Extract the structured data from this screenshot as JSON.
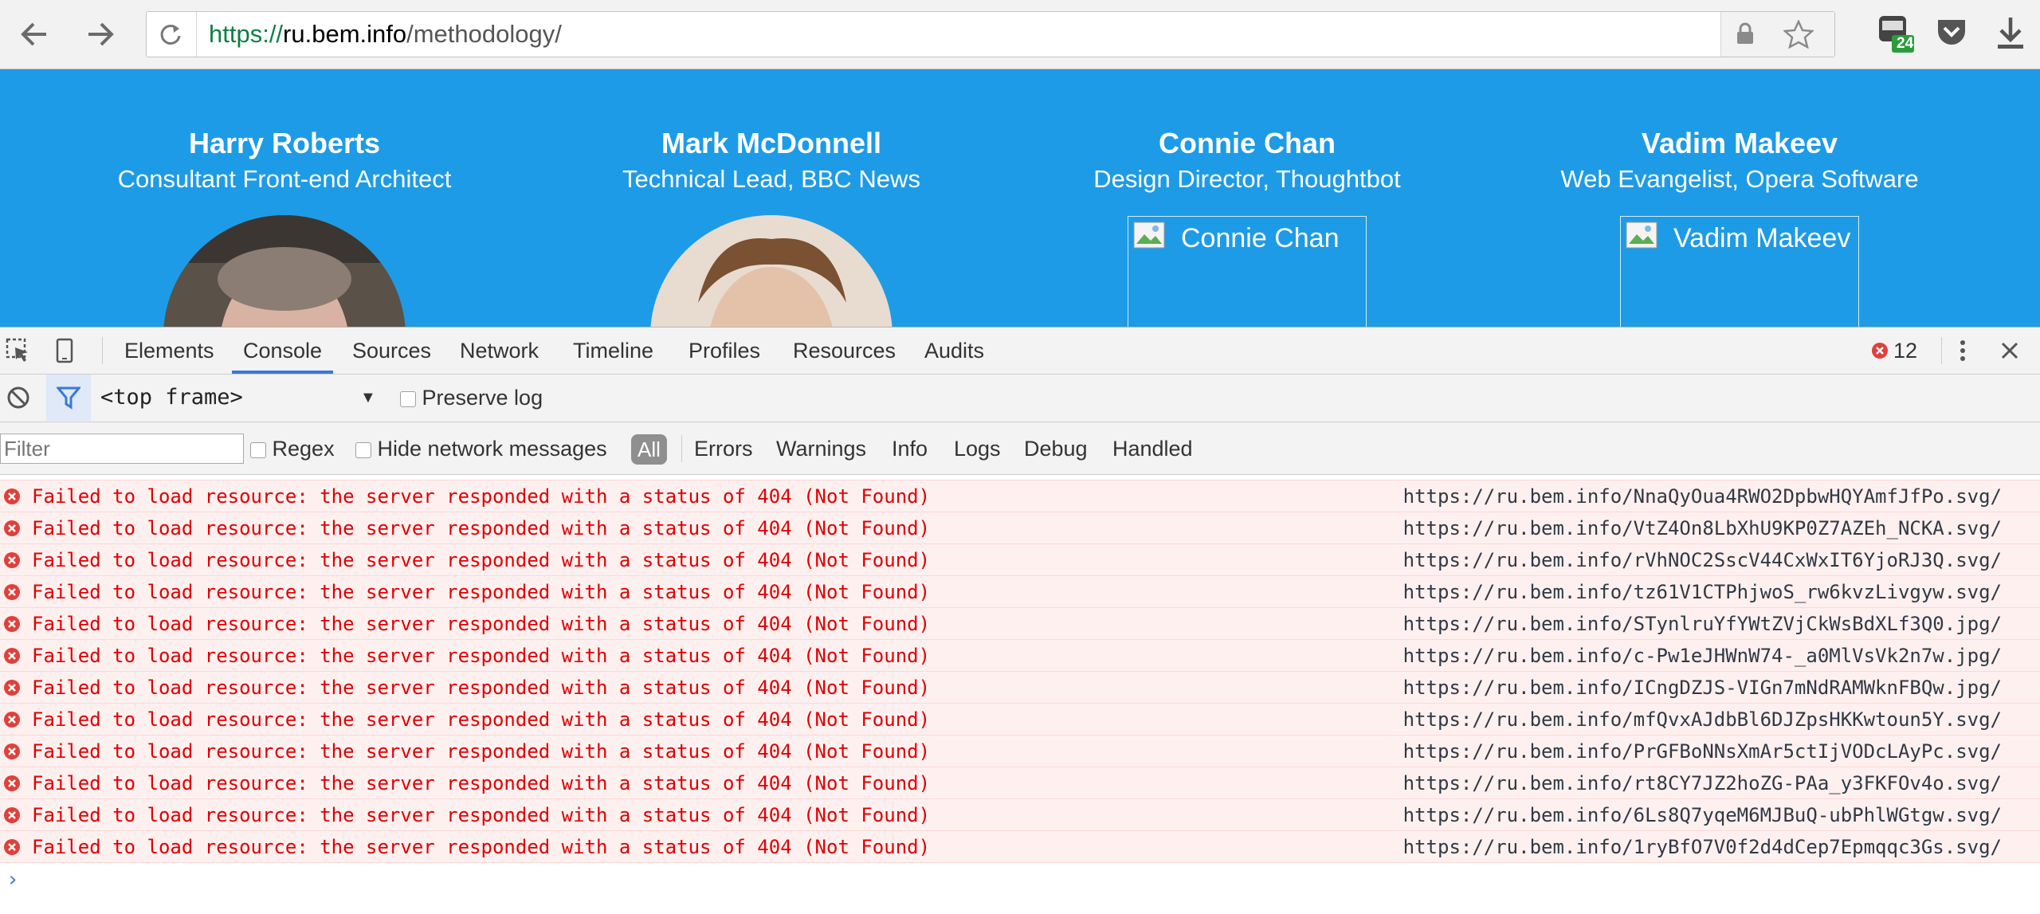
{
  "browser": {
    "url_scheme": "https://",
    "url_host": "ru.bem.info",
    "url_path": "/methodology/",
    "extension_badge": "24"
  },
  "page": {
    "people": [
      {
        "name": "Harry Roberts",
        "title": "Consultant Front-end Architect",
        "image_alt": ""
      },
      {
        "name": "Mark McDonnell",
        "title": "Technical Lead, BBC News",
        "image_alt": ""
      },
      {
        "name": "Connie Chan",
        "title": "Design Director, Thoughtbot",
        "image_alt": "Connie Chan"
      },
      {
        "name": "Vadim Makeev",
        "title": "Web Evangelist, Opera Software",
        "image_alt": "Vadim Makeev"
      }
    ]
  },
  "devtools": {
    "tabs": [
      "Elements",
      "Console",
      "Sources",
      "Network",
      "Timeline",
      "Profiles",
      "Resources",
      "Audits"
    ],
    "active_tab": "Console",
    "error_count": "12",
    "frame": "<top frame>",
    "preserve_log": "Preserve log",
    "filter_placeholder": "Filter",
    "regex": "Regex",
    "hide_network": "Hide network messages",
    "levels": [
      "All",
      "Errors",
      "Warnings",
      "Info",
      "Logs",
      "Debug",
      "Handled"
    ]
  },
  "console": {
    "messages": [
      {
        "text": "Failed to load resource: the server responded with a status of 404 (Not Found)",
        "source": "https://ru.bem.info/NnaQyOua4RWO2DpbwHQYAmfJfPo.svg/"
      },
      {
        "text": "Failed to load resource: the server responded with a status of 404 (Not Found)",
        "source": "https://ru.bem.info/VtZ4On8LbXhU9KP0Z7AZEh_NCKA.svg/"
      },
      {
        "text": "Failed to load resource: the server responded with a status of 404 (Not Found)",
        "source": "https://ru.bem.info/rVhNOC2SscV44CxWxIT6YjoRJ3Q.svg/"
      },
      {
        "text": "Failed to load resource: the server responded with a status of 404 (Not Found)",
        "source": "https://ru.bem.info/tz61V1CTPhjwoS_rw6kvzLivgyw.svg/"
      },
      {
        "text": "Failed to load resource: the server responded with a status of 404 (Not Found)",
        "source": "https://ru.bem.info/STynlruYfYWtZVjCkWsBdXLf3Q0.jpg/"
      },
      {
        "text": "Failed to load resource: the server responded with a status of 404 (Not Found)",
        "source": "https://ru.bem.info/c-Pw1eJHWnW74-_a0MlVsVk2n7w.jpg/"
      },
      {
        "text": "Failed to load resource: the server responded with a status of 404 (Not Found)",
        "source": "https://ru.bem.info/ICngDZJS-VIGn7mNdRAMWknFBQw.jpg/"
      },
      {
        "text": "Failed to load resource: the server responded with a status of 404 (Not Found)",
        "source": "https://ru.bem.info/mfQvxAJdbBl6DJZpsHKKwtoun5Y.svg/"
      },
      {
        "text": "Failed to load resource: the server responded with a status of 404 (Not Found)",
        "source": "https://ru.bem.info/PrGFBoNNsXmAr5ctIjVODcLAyPc.svg/"
      },
      {
        "text": "Failed to load resource: the server responded with a status of 404 (Not Found)",
        "source": "https://ru.bem.info/rt8CY7JZ2hoZG-PAa_y3FKFOv4o.svg/"
      },
      {
        "text": "Failed to load resource: the server responded with a status of 404 (Not Found)",
        "source": "https://ru.bem.info/6Ls8Q7yqeM6MJBuQ-ubPhlWGtgw.svg/"
      },
      {
        "text": "Failed to load resource: the server responded with a status of 404 (Not Found)",
        "source": "https://ru.bem.info/1ryBfO7V0f2d4dCep7Epmqqc3Gs.svg/"
      }
    ],
    "prompt": "›"
  },
  "colors": {
    "page_bg": "#1e9be6",
    "error_text": "#e00000",
    "error_bg": "#fff0f0",
    "accent": "#3879d9"
  }
}
